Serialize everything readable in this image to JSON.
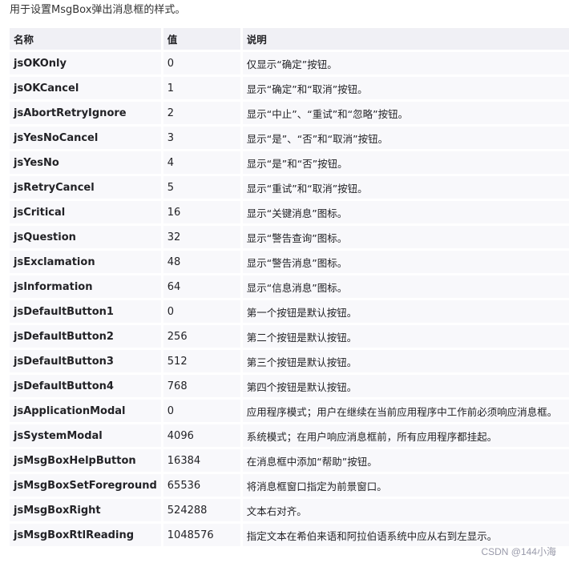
{
  "intro": "用于设置MsgBox弹出消息框的样式。",
  "table": {
    "headers": {
      "name": "名称",
      "value": "值",
      "description": "说明"
    },
    "rows": [
      {
        "name": "jsOKOnly",
        "value": "0",
        "description": "仅显示“确定”按钮。"
      },
      {
        "name": "jsOKCancel",
        "value": "1",
        "description": "显示“确定”和“取消”按钮。"
      },
      {
        "name": "jsAbortRetryIgnore",
        "value": "2",
        "description": "显示“中止”、“重试”和“忽略”按钮。"
      },
      {
        "name": "jsYesNoCancel",
        "value": "3",
        "description": "显示“是”、“否”和“取消”按钮。"
      },
      {
        "name": "jsYesNo",
        "value": "4",
        "description": "显示“是”和“否”按钮。"
      },
      {
        "name": "jsRetryCancel",
        "value": "5",
        "description": "显示“重试”和“取消”按钮。"
      },
      {
        "name": "jsCritical",
        "value": "16",
        "description": "显示“关键消息”图标。"
      },
      {
        "name": "jsQuestion",
        "value": "32",
        "description": "显示“警告查询”图标。"
      },
      {
        "name": "jsExclamation",
        "value": "48",
        "description": "显示“警告消息”图标。"
      },
      {
        "name": "jsInformation",
        "value": "64",
        "description": "显示“信息消息”图标。"
      },
      {
        "name": "jsDefaultButton1",
        "value": "0",
        "description": "第一个按钮是默认按钮。"
      },
      {
        "name": "jsDefaultButton2",
        "value": "256",
        "description": "第二个按钮是默认按钮。"
      },
      {
        "name": "jsDefaultButton3",
        "value": "512",
        "description": "第三个按钮是默认按钮。"
      },
      {
        "name": "jsDefaultButton4",
        "value": "768",
        "description": "第四个按钮是默认按钮。"
      },
      {
        "name": "jsApplicationModal",
        "value": "0",
        "description": "应用程序模式；用户在继续在当前应用程序中工作前必须响应消息框。"
      },
      {
        "name": "jsSystemModal",
        "value": "4096",
        "description": "系统模式；在用户响应消息框前，所有应用程序都挂起。"
      },
      {
        "name": "jsMsgBoxHelpButton",
        "value": "16384",
        "description": "在消息框中添加“帮助”按钮。"
      },
      {
        "name": "jsMsgBoxSetForeground",
        "value": "65536",
        "description": "将消息框窗口指定为前景窗口。"
      },
      {
        "name": "jsMsgBoxRight",
        "value": "524288",
        "description": "文本右对齐。"
      },
      {
        "name": "jsMsgBoxRtlReading",
        "value": "1048576",
        "description": "指定文本在希伯来语和阿拉伯语系统中应从右到左显示。"
      }
    ]
  },
  "watermark": "CSDN @144小海"
}
